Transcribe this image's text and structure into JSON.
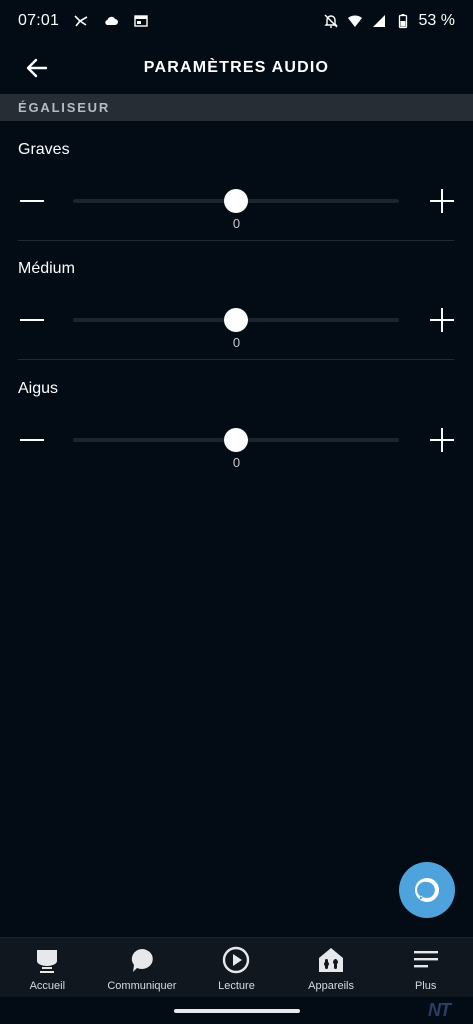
{
  "status_bar": {
    "time": "07:01",
    "battery": "53 %",
    "left_icons": [
      "fox-icon",
      "cloud-icon",
      "browser-window-icon"
    ],
    "right_icons": [
      "bell-off-icon",
      "wifi-icon",
      "signal-icon",
      "battery-icon"
    ]
  },
  "header": {
    "title": "PARAMÈTRES AUDIO",
    "back_icon": "arrow-left-icon"
  },
  "section": {
    "title": "ÉGALISEUR"
  },
  "equalizer": {
    "bands": [
      {
        "label": "Graves",
        "value": "0",
        "level": 0,
        "min": -6,
        "max": 6
      },
      {
        "label": "Médium",
        "value": "0",
        "level": 0,
        "min": -6,
        "max": 6
      },
      {
        "label": "Aigus",
        "value": "0",
        "level": 0,
        "min": -6,
        "max": 6
      }
    ]
  },
  "nav": {
    "items": [
      {
        "label": "Accueil",
        "icon": "home-icon"
      },
      {
        "label": "Communiquer",
        "icon": "chat-bubble-icon"
      },
      {
        "label": "Lecture",
        "icon": "play-circle-icon"
      },
      {
        "label": "Appareils",
        "icon": "smart-home-icon"
      },
      {
        "label": "Plus",
        "icon": "menu-lines-icon"
      }
    ]
  },
  "watermark": "NT",
  "colors": {
    "background": "#030b14",
    "section_bg": "#262d35",
    "alexa_blue": "#4fa3dc",
    "nav_bg": "#11171f"
  }
}
